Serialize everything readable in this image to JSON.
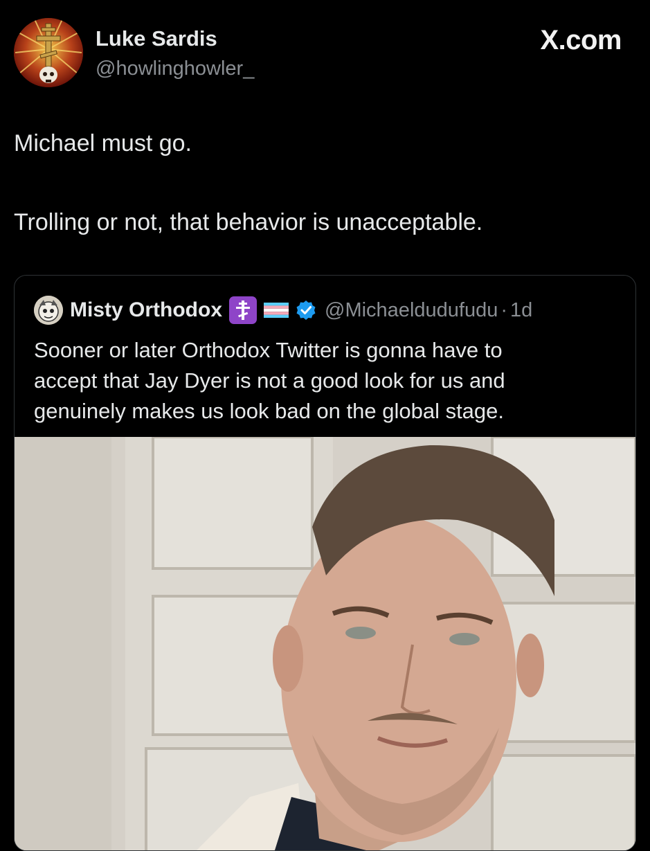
{
  "tweet": {
    "author": {
      "display_name": "Luke Sardis",
      "handle": "@howlinghowler_",
      "avatar_icon": "orthodox-cross-skull-avatar-icon"
    },
    "brand": "X.com",
    "text_lines": [
      "Michael must go.",
      "Trolling or not, that behavior is unacceptable."
    ]
  },
  "quoted_tweet": {
    "author": {
      "display_name": "Misty Orthodox",
      "handle": "@Michaeldudufudu",
      "time": "1d",
      "separator": "·",
      "avatar_icon": "cartoon-face-avatar-icon",
      "name_emojis": [
        "orthodox-cross-emoji-icon",
        "transgender-flag-emoji-icon"
      ],
      "verified_icon": "verified-badge-icon"
    },
    "text_lines": [
      "Sooner or later Orthodox Twitter is gonna have to",
      "accept that Jay Dyer is not a good look for us and",
      "genuinely makes us look bad on the global stage."
    ],
    "media": {
      "type": "photo",
      "description_icon": "portrait-photo"
    }
  },
  "colors": {
    "background": "#000000",
    "primary_text": "#e7e9ea",
    "secondary_text": "#8b8f94",
    "card_border": "#2f3336",
    "verified_blue": "#1d9bf0",
    "emoji_purple": "#8e44c8"
  }
}
